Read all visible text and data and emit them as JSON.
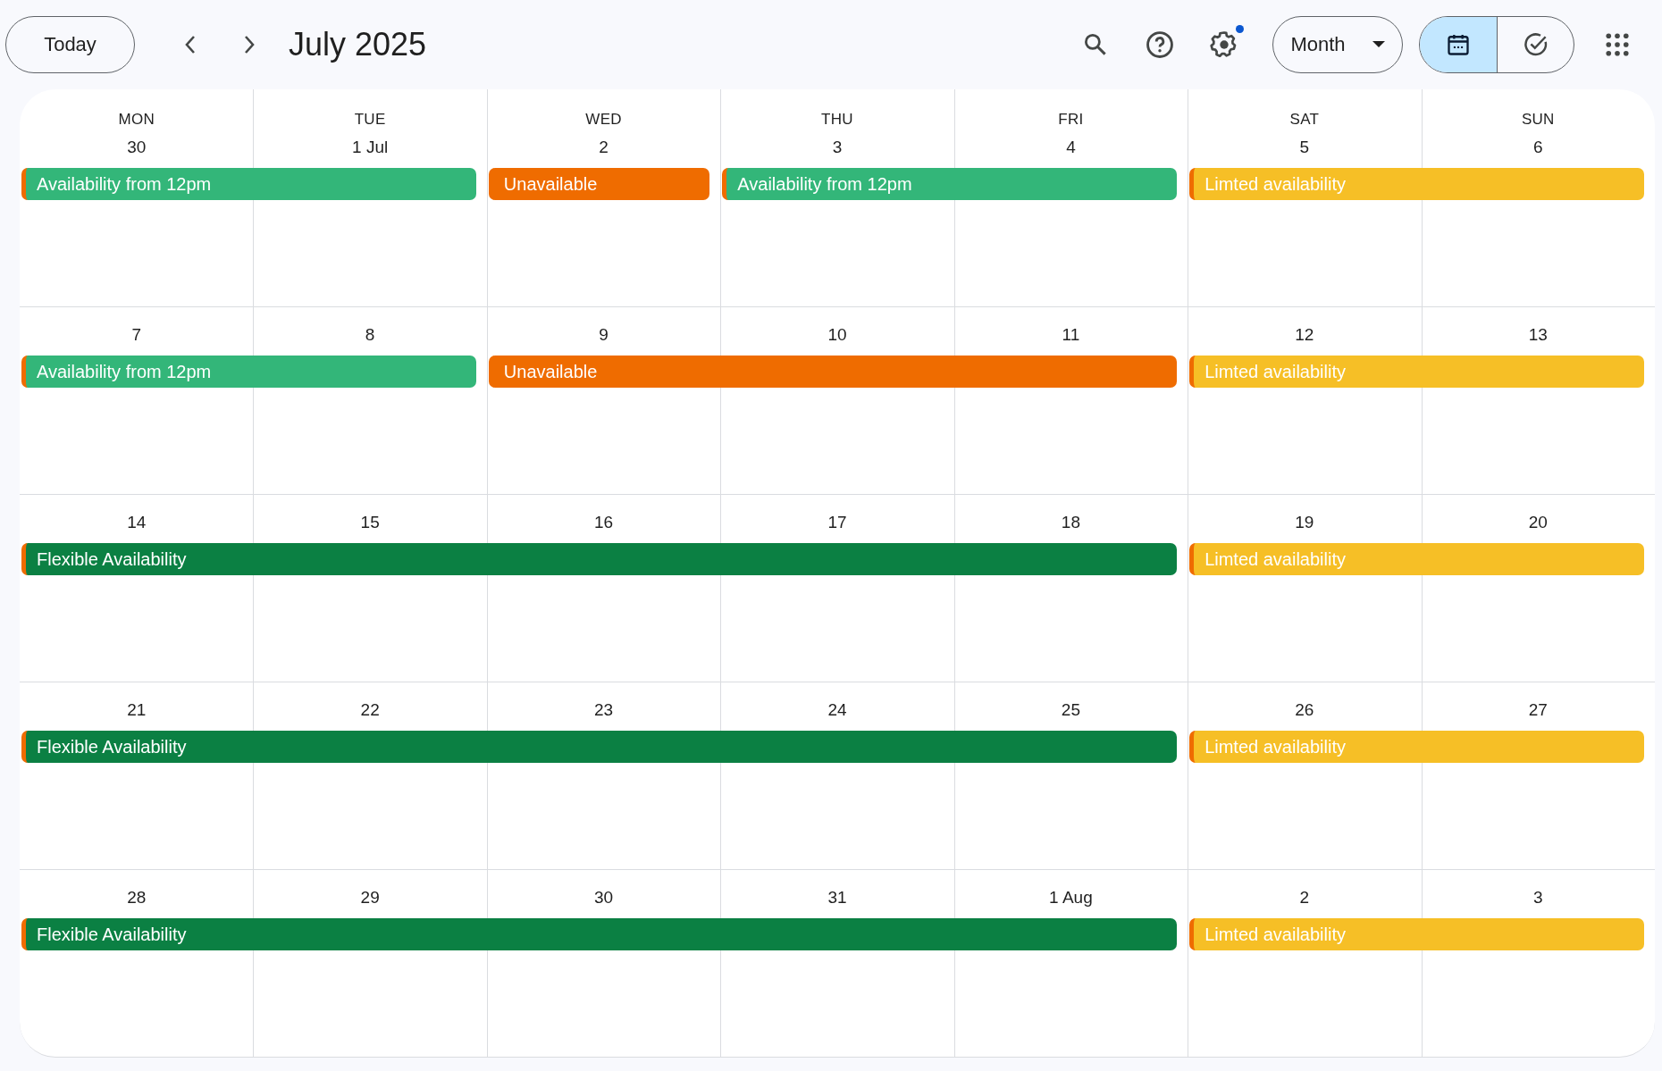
{
  "toolbar": {
    "today_button": "Today",
    "title": "July 2025",
    "view_menu": "Month",
    "settings_badge": true,
    "view_toggle": [
      {
        "kind": "calendar",
        "selected": true
      },
      {
        "kind": "tasks",
        "selected": false
      }
    ]
  },
  "weekdays": [
    "MON",
    "TUE",
    "WED",
    "THU",
    "FRI",
    "SAT",
    "SUN"
  ],
  "weeks": [
    {
      "days": [
        {
          "date": "30",
          "event": {
            "title": "Availability from 12pm",
            "color": "#33b679"
          }
        },
        {
          "date": "1 Jul",
          "continues": true
        },
        {
          "date": "2",
          "event": {
            "title": "Unavailable",
            "color": "#ef6c00"
          }
        },
        {
          "date": "3",
          "event": {
            "title": "Availability from 12pm",
            "color": "#33b679"
          }
        },
        {
          "date": "4",
          "continues": true
        },
        {
          "date": "5",
          "event": {
            "title": "Limted availability",
            "color": "#f6bf26"
          }
        },
        {
          "date": "6",
          "continues": true
        }
      ]
    },
    {
      "days": [
        {
          "date": "7",
          "event": {
            "title": "Availability from 12pm",
            "color": "#33b679"
          }
        },
        {
          "date": "8",
          "continues": true
        },
        {
          "date": "9",
          "event": {
            "title": "Unavailable",
            "color": "#ef6c00"
          }
        },
        {
          "date": "10",
          "continues": true
        },
        {
          "date": "11",
          "continues": true
        },
        {
          "date": "12",
          "event": {
            "title": "Limted availability",
            "color": "#f6bf26"
          }
        },
        {
          "date": "13",
          "continues": true
        }
      ]
    },
    {
      "days": [
        {
          "date": "14",
          "event": {
            "title": "Flexible Availability",
            "color": "#0b8043"
          }
        },
        {
          "date": "15",
          "continues": true
        },
        {
          "date": "16",
          "continues": true
        },
        {
          "date": "17",
          "continues": true
        },
        {
          "date": "18",
          "continues": true
        },
        {
          "date": "19",
          "event": {
            "title": "Limted availability",
            "color": "#f6bf26"
          }
        },
        {
          "date": "20",
          "continues": true
        }
      ]
    },
    {
      "days": [
        {
          "date": "21",
          "event": {
            "title": "Flexible Availability",
            "color": "#0b8043"
          }
        },
        {
          "date": "22",
          "continues": true
        },
        {
          "date": "23",
          "continues": true
        },
        {
          "date": "24",
          "continues": true
        },
        {
          "date": "25",
          "continues": true
        },
        {
          "date": "26",
          "event": {
            "title": "Limted availability",
            "color": "#f6bf26"
          }
        },
        {
          "date": "27",
          "continues": true
        }
      ]
    },
    {
      "days": [
        {
          "date": "28",
          "event": {
            "title": "Flexible Availability",
            "color": "#0b8043"
          }
        },
        {
          "date": "29",
          "continues": true
        },
        {
          "date": "30",
          "continues": true
        },
        {
          "date": "31",
          "continues": true
        },
        {
          "date": "1 Aug",
          "continues": true
        },
        {
          "date": "2",
          "event": {
            "title": "Limted availability",
            "color": "#f6bf26"
          }
        },
        {
          "date": "3",
          "continues": true
        }
      ]
    }
  ]
}
